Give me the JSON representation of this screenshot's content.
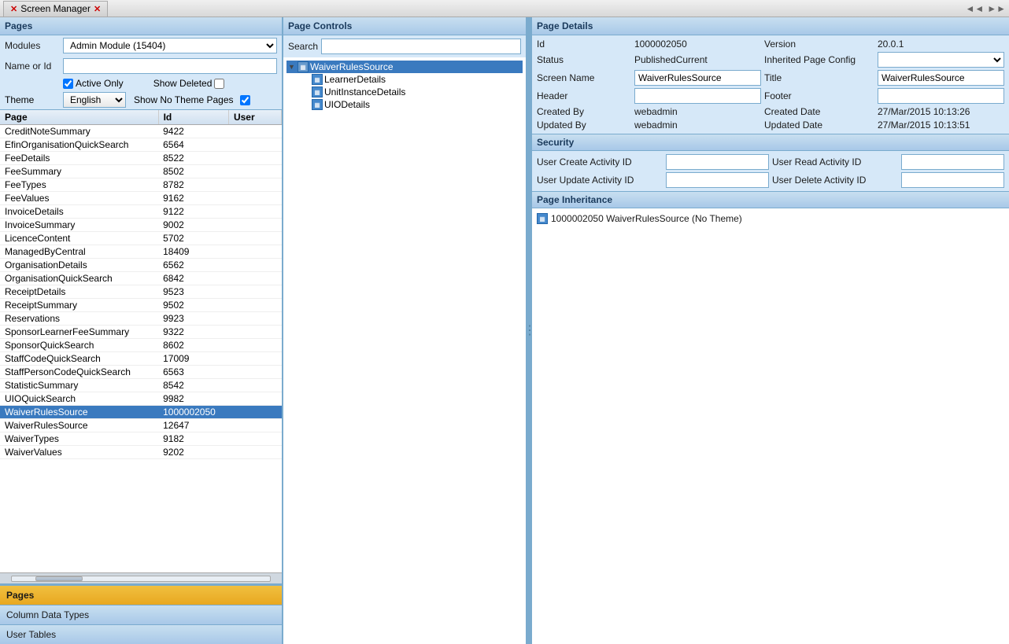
{
  "titleBar": {
    "appName": "Screen Manager",
    "closeLabel": "✕",
    "navLeft": "◄◄",
    "navRight": "►►"
  },
  "leftPanel": {
    "header": "Pages",
    "modulesLabel": "Modules",
    "modulesValue": "Admin Module (15404)",
    "nameOrIdLabel": "Name or Id",
    "activeOnlyLabel": "Active Only",
    "showDeletedLabel": "Show Deleted",
    "themeLabel": "Theme",
    "themeValue": "English",
    "showNoThemePagesLabel": "Show No Theme Pages",
    "tableHeaders": [
      "Page",
      "Id",
      "User"
    ],
    "rows": [
      {
        "page": "CreditNoteSummary",
        "id": "9422",
        "user": ""
      },
      {
        "page": "EfinOrganisationQuickSearch",
        "id": "6564",
        "user": ""
      },
      {
        "page": "FeeDetails",
        "id": "8522",
        "user": ""
      },
      {
        "page": "FeeSummary",
        "id": "8502",
        "user": ""
      },
      {
        "page": "FeeTypes",
        "id": "8782",
        "user": ""
      },
      {
        "page": "FeeValues",
        "id": "9162",
        "user": ""
      },
      {
        "page": "InvoiceDetails",
        "id": "9122",
        "user": ""
      },
      {
        "page": "InvoiceSummary",
        "id": "9002",
        "user": ""
      },
      {
        "page": "LicenceContent",
        "id": "5702",
        "user": ""
      },
      {
        "page": "ManagedByCentral",
        "id": "18409",
        "user": ""
      },
      {
        "page": "OrganisationDetails",
        "id": "6562",
        "user": ""
      },
      {
        "page": "OrganisationQuickSearch",
        "id": "6842",
        "user": ""
      },
      {
        "page": "ReceiptDetails",
        "id": "9523",
        "user": ""
      },
      {
        "page": "ReceiptSummary",
        "id": "9502",
        "user": ""
      },
      {
        "page": "Reservations",
        "id": "9923",
        "user": ""
      },
      {
        "page": "SponsorLearnerFeeSummary",
        "id": "9322",
        "user": ""
      },
      {
        "page": "SponsorQuickSearch",
        "id": "8602",
        "user": ""
      },
      {
        "page": "StaffCodeQuickSearch",
        "id": "17009",
        "user": ""
      },
      {
        "page": "StaffPersonCodeQuickSearch",
        "id": "6563",
        "user": ""
      },
      {
        "page": "StatisticSummary",
        "id": "8542",
        "user": ""
      },
      {
        "page": "UIOQuickSearch",
        "id": "9982",
        "user": ""
      },
      {
        "page": "WaiverRulesSource",
        "id": "1000002050",
        "user": "",
        "selected": true
      },
      {
        "page": "WaiverRulesSource",
        "id": "12647",
        "user": ""
      },
      {
        "page": "WaiverTypes",
        "id": "9182",
        "user": ""
      },
      {
        "page": "WaiverValues",
        "id": "9202",
        "user": ""
      }
    ],
    "bottomTabs": [
      "Pages",
      "Column Data Types",
      "User Tables"
    ]
  },
  "middlePanel": {
    "header": "Page Controls",
    "searchLabel": "Search",
    "searchValue": "",
    "treeItems": [
      {
        "label": "WaiverRulesSource",
        "level": 0,
        "expanded": true,
        "selected": true,
        "hasArrow": true
      },
      {
        "label": "LearnerDetails",
        "level": 1,
        "selected": false,
        "hasArrow": false
      },
      {
        "label": "UnitInstanceDetails",
        "level": 1,
        "selected": false,
        "hasArrow": false
      },
      {
        "label": "UIODetails",
        "level": 1,
        "selected": false,
        "hasArrow": false
      }
    ]
  },
  "rightPanel": {
    "header": "Page Details",
    "fields": {
      "idLabel": "Id",
      "idValue": "1000002050",
      "versionLabel": "Version",
      "versionValue": "20.0.1",
      "statusLabel": "Status",
      "statusValue": "PublishedCurrent",
      "inheritedPageConfigLabel": "Inherited Page Config",
      "inheritedPageConfigValue": "",
      "screenNameLabel": "Screen Name",
      "screenNameValue": "WaiverRulesSource",
      "titleLabel": "Title",
      "titleValue": "WaiverRulesSource",
      "headerLabel": "Header",
      "headerValue": "",
      "footerLabel": "Footer",
      "footerValue": "",
      "createdByLabel": "Created By",
      "createdByValue": "webadmin",
      "createdDateLabel": "Created Date",
      "createdDateValue": "27/Mar/2015 10:13:26",
      "updatedByLabel": "Updated By",
      "updatedByValue": "webadmin",
      "updatedDateLabel": "Updated Date",
      "updatedDateValue": "27/Mar/2015 10:13:51"
    },
    "security": {
      "header": "Security",
      "userCreateActivityIdLabel": "User Create Activity ID",
      "userCreateActivityIdValue": "",
      "userReadActivityIdLabel": "User Read Activity ID",
      "userReadActivityIdValue": "",
      "userUpdateActivityIdLabel": "User Update Activity ID",
      "userUpdateActivityIdValue": "",
      "userDeleteActivityIdLabel": "User Delete Activity ID",
      "userDeleteActivityIdValue": ""
    },
    "inheritance": {
      "header": "Page Inheritance",
      "items": [
        {
          "label": "1000002050 WaiverRulesSource (No Theme)"
        }
      ]
    }
  }
}
